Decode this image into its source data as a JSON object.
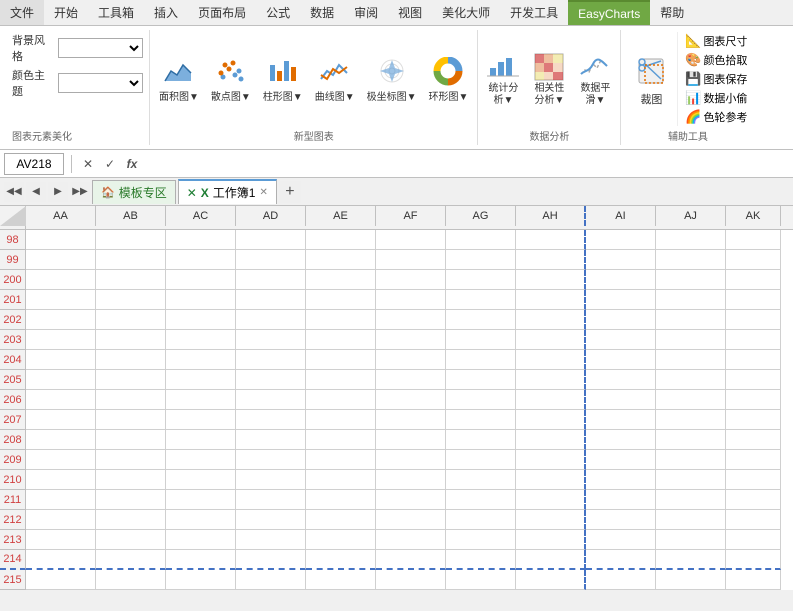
{
  "ribbon": {
    "tabs": [
      "文件",
      "开始",
      "工具箱",
      "插入",
      "页面布局",
      "公式",
      "数据",
      "审阅",
      "视图",
      "美化大师",
      "开发工具",
      "EasyCharts",
      "帮助"
    ],
    "active_tab": "EasyCharts",
    "groups": {
      "style": {
        "label": "图表元素美化",
        "background_style_label": "背景风格",
        "color_theme_label": "颜色主题"
      },
      "new_chart": {
        "label": "新型图表",
        "items": [
          {
            "label": "面积图▼",
            "name": "area-chart"
          },
          {
            "label": "散点图▼",
            "name": "scatter-chart"
          },
          {
            "label": "柱形图▼",
            "name": "bar-chart"
          },
          {
            "label": "曲线图▼",
            "name": "line-chart"
          },
          {
            "label": "极坐标图▼",
            "name": "polar-chart"
          },
          {
            "label": "环形图▼",
            "name": "ring-chart"
          }
        ]
      },
      "data_analysis": {
        "label": "数据分析",
        "items": [
          {
            "label": "统计分\n析▼",
            "name": "stat-analysis"
          },
          {
            "label": "相关性\n分析▼",
            "name": "correlation"
          },
          {
            "label": "数据平\n滑▼",
            "name": "smooth"
          }
        ]
      },
      "assist": {
        "label": "辅助工具",
        "crop_label": "裁图",
        "right_items": [
          {
            "label": "图表尺寸",
            "name": "chart-size"
          },
          {
            "label": "颜色拾取",
            "name": "color-pick"
          },
          {
            "label": "图表保存",
            "name": "chart-save"
          },
          {
            "label": "数据小偷",
            "name": "data-steal"
          },
          {
            "label": "色轮参考",
            "name": "color-wheel"
          }
        ]
      }
    }
  },
  "formula_bar": {
    "cell_ref": "AV218",
    "cancel_label": "✕",
    "confirm_label": "✓",
    "fx_label": "fx"
  },
  "tabs_bar": {
    "template_tab": "模板专区",
    "sheet_tab": "工作簿1",
    "add_label": "+"
  },
  "spreadsheet": {
    "columns": [
      "AA",
      "AB",
      "AC",
      "AD",
      "AE",
      "AF",
      "AG",
      "AH",
      "AI",
      "AJ",
      "AK"
    ],
    "rows": [
      "98",
      "99",
      "200",
      "201",
      "202",
      "203",
      "204",
      "205",
      "206",
      "207",
      "208",
      "209",
      "210",
      "211",
      "212",
      "213",
      "214",
      "215"
    ],
    "dashed_col_index": 7,
    "dashed_bottom_row_index": 16
  }
}
